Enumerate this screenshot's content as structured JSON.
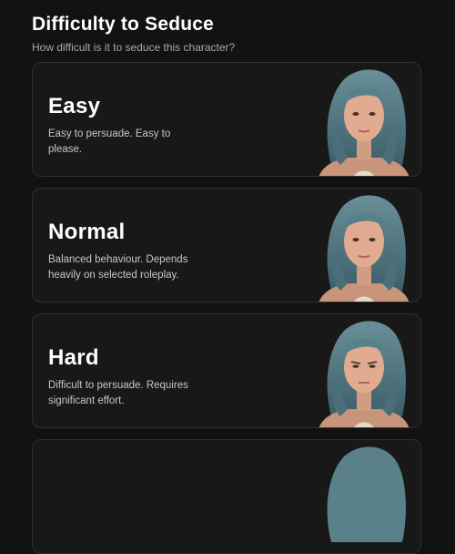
{
  "header": {
    "title": "Difficulty to Seduce",
    "subtitle": "How difficult is it to seduce this character?"
  },
  "options": [
    {
      "title": "Easy",
      "description": "Easy to persuade. Easy to please."
    },
    {
      "title": "Normal",
      "description": "Balanced behaviour. Depends heavily on selected roleplay."
    },
    {
      "title": "Hard",
      "description": "Difficult to persuade. Requires significant effort."
    }
  ],
  "colors": {
    "background": "#121212",
    "card": "#181818",
    "card_border": "#2f2f2f",
    "hair": "#4f7580"
  }
}
